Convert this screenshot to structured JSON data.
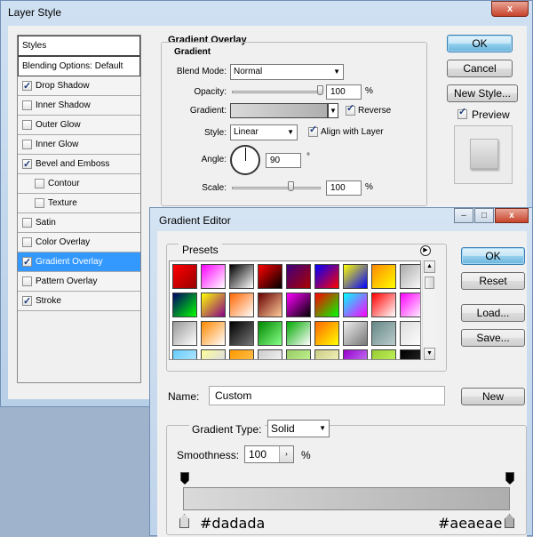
{
  "layer_style": {
    "title": "Layer Style",
    "close_glyph": "x",
    "styles_header": "Styles",
    "blending_options": "Blending Options: Default",
    "items": [
      {
        "label": "Drop Shadow",
        "checked": true,
        "sub": false,
        "selected": false
      },
      {
        "label": "Inner Shadow",
        "checked": false,
        "sub": false,
        "selected": false
      },
      {
        "label": "Outer Glow",
        "checked": false,
        "sub": false,
        "selected": false
      },
      {
        "label": "Inner Glow",
        "checked": false,
        "sub": false,
        "selected": false
      },
      {
        "label": "Bevel and Emboss",
        "checked": true,
        "sub": false,
        "selected": false
      },
      {
        "label": "Contour",
        "checked": false,
        "sub": true,
        "selected": false
      },
      {
        "label": "Texture",
        "checked": false,
        "sub": true,
        "selected": false
      },
      {
        "label": "Satin",
        "checked": false,
        "sub": false,
        "selected": false
      },
      {
        "label": "Color Overlay",
        "checked": false,
        "sub": false,
        "selected": false
      },
      {
        "label": "Gradient Overlay",
        "checked": true,
        "sub": false,
        "selected": true
      },
      {
        "label": "Pattern Overlay",
        "checked": false,
        "sub": false,
        "selected": false
      },
      {
        "label": "Stroke",
        "checked": true,
        "sub": false,
        "selected": false
      }
    ],
    "panel_title": "Gradient Overlay",
    "group_title": "Gradient",
    "blend_mode_label": "Blend Mode:",
    "blend_mode_value": "Normal",
    "opacity_label": "Opacity:",
    "opacity_value": "100",
    "opacity_percent": 100,
    "percent_unit": "%",
    "gradient_label": "Gradient:",
    "reverse_label": "Reverse",
    "reverse_checked": true,
    "style_label": "Style:",
    "style_value": "Linear",
    "align_label": "Align with Layer",
    "align_checked": true,
    "angle_label": "Angle:",
    "angle_value": "90",
    "degree_unit": "°",
    "scale_label": "Scale:",
    "scale_value": "100",
    "scale_percent": 100,
    "ok_label": "OK",
    "cancel_label": "Cancel",
    "new_style_label": "New Style...",
    "preview_label": "Preview",
    "preview_checked": true
  },
  "gradient_editor": {
    "title": "Gradient Editor",
    "minimize_glyph": "–",
    "maximize_glyph": "□",
    "close_glyph": "x",
    "presets_label": "Presets",
    "presets_menu_glyph": "▶",
    "ok_label": "OK",
    "reset_label": "Reset",
    "load_label": "Load...",
    "save_label": "Save...",
    "name_label": "Name:",
    "name_value": "Custom",
    "new_label": "New",
    "gradient_type_label": "Gradient Type:",
    "gradient_type_value": "Solid",
    "smoothness_label": "Smoothness:",
    "smoothness_value": "100",
    "smoothness_unit": "%",
    "stop_left_color": "#dadada",
    "stop_right_color": "#aeaeae"
  },
  "colors": {
    "selection_blue": "#3399ff",
    "stop_left": "#dadada",
    "stop_right": "#aeaeae"
  }
}
